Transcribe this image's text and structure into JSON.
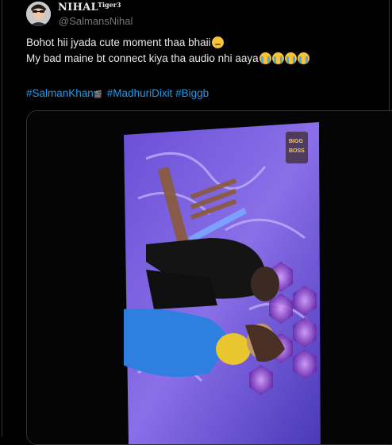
{
  "user": {
    "display_name": "NIHAL",
    "badge": "Tiger3",
    "handle": "@SalmansNihal"
  },
  "tweet": {
    "line1": "Bohot hii jyada cute moment thaa bhaii",
    "line1_emoji": "woozy-face",
    "line2": "My bad maine bt connect kiya tha audio nhi aaya",
    "line2_emojis": [
      "crying-face",
      "crying-face",
      "crying-face",
      "crying-face"
    ],
    "hashtags": [
      "#SalmanKhan",
      "#MadhuriDixit",
      "#Biggb"
    ],
    "hashtag_icon": "film-clapper-icon"
  },
  "media": {
    "type": "video-photo",
    "overlay_logo_text": "BIGG BOSS"
  },
  "colors": {
    "background": "#000000",
    "text": "#e7e9ea",
    "muted": "#71767b",
    "link": "#1d9bf0",
    "border": "#2f3336"
  }
}
